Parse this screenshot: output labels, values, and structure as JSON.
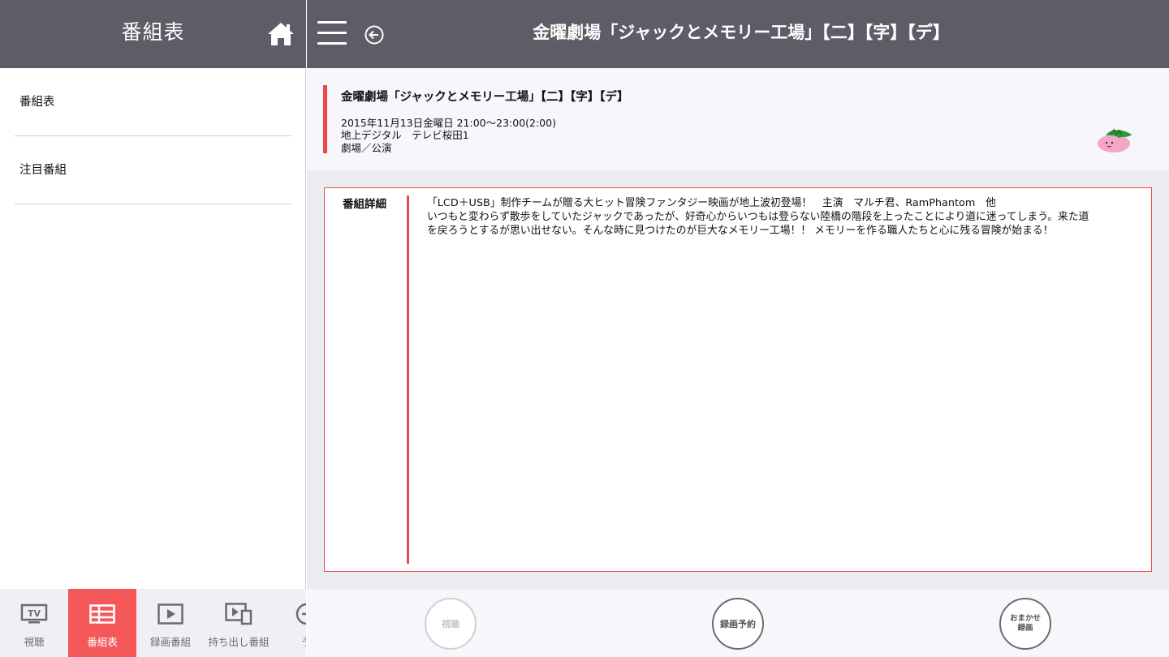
{
  "sidebar": {
    "title": "番組表",
    "items": [
      {
        "label": "番組表"
      },
      {
        "label": "注目番組"
      }
    ]
  },
  "tabs": [
    {
      "label": "視聴",
      "icon": "tv-icon"
    },
    {
      "label": "番組表",
      "icon": "grid-icon",
      "active": true
    },
    {
      "label": "録画番組",
      "icon": "play-icon"
    },
    {
      "label": "持ち出し番組",
      "icon": "portable-play-icon"
    },
    {
      "label": "予",
      "icon": "reserve-icon"
    }
  ],
  "header": {
    "title": "金曜劇場「ジャックとメモリー工場」【二】【字】【デ】"
  },
  "program": {
    "title": "金曜劇場「ジャックとメモリー工場」【二】【字】【デ】",
    "datetime": "2015年11月13日金曜日 21:00〜23:00(2:00)",
    "channel": "地上デジタル　テレビ桜田1",
    "genre": "劇場／公演"
  },
  "detail": {
    "label": "番組詳細",
    "lines": [
      "「LCD＋USB」制作チームが贈る大ヒット冒険ファンタジー映画が地上波初登場！　主演　マルチ君、RamPhantom　他",
      "いつもと変わらず散歩をしていたジャックであったが、好奇心からいつもは登らない陸橋の階段を上ったことにより道に迷ってしまう。来た道",
      "を戻ろうとするが思い出せない。そんな時に見つけたのが巨大なメモリー工場！！ メモリーを作る職人たちと心に残る冒険が始まる！"
    ]
  },
  "actions": {
    "watch": "視聴",
    "record_reserve": "録画予約",
    "auto_record_line1": "おまかせ",
    "auto_record_line2": "録画"
  },
  "colors": {
    "header_bg": "#5c5d66",
    "accent": "#e84b4b",
    "active_tab": "#f55858"
  }
}
